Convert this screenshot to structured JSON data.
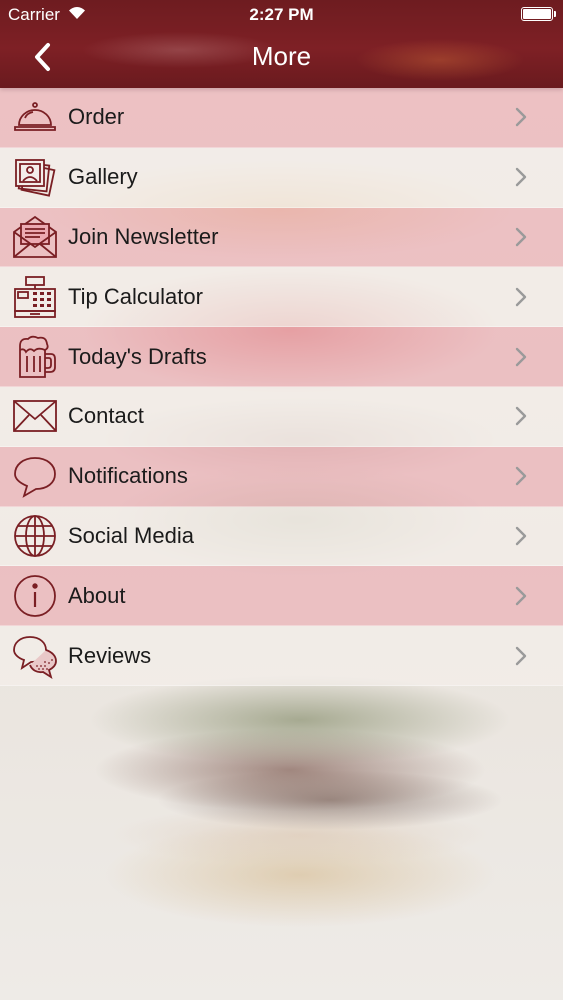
{
  "status_bar": {
    "carrier": "Carrier",
    "time": "2:27 PM",
    "battery_percent": 100
  },
  "nav": {
    "title": "More",
    "back_icon": "chevron-left-icon"
  },
  "colors": {
    "header": "#7a1f24",
    "icon_stroke": "#7a1f24",
    "row_pink": "#ecaab2",
    "row_light": "#f4eeea",
    "chevron": "#9a9a9a"
  },
  "menu": {
    "items": [
      {
        "label": "Order",
        "icon": "service-bell-icon"
      },
      {
        "label": "Gallery",
        "icon": "photo-stack-icon"
      },
      {
        "label": "Join Newsletter",
        "icon": "newsletter-envelope-icon"
      },
      {
        "label": "Tip Calculator",
        "icon": "cash-register-icon"
      },
      {
        "label": "Today's Drafts",
        "icon": "beer-mug-icon"
      },
      {
        "label": "Contact",
        "icon": "envelope-icon"
      },
      {
        "label": "Notifications",
        "icon": "speech-bubble-icon"
      },
      {
        "label": "Social Media",
        "icon": "globe-icon"
      },
      {
        "label": "About",
        "icon": "info-icon"
      },
      {
        "label": "Reviews",
        "icon": "chat-bubbles-icon"
      }
    ]
  }
}
